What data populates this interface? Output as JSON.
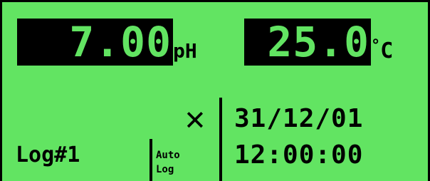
{
  "display": {
    "background_color": "#62e462",
    "readout_background": "#000000",
    "ph": {
      "value": "7.00",
      "unit": "pH"
    },
    "temperature": {
      "value": "25.0",
      "degree_symbol": "°",
      "unit": "C"
    },
    "log": {
      "label": "Log#1",
      "auto_log_line1": "Auto",
      "auto_log_line2": "Log",
      "status_symbol": "✕"
    },
    "date": "31/12/01",
    "time": "12:00:00"
  }
}
